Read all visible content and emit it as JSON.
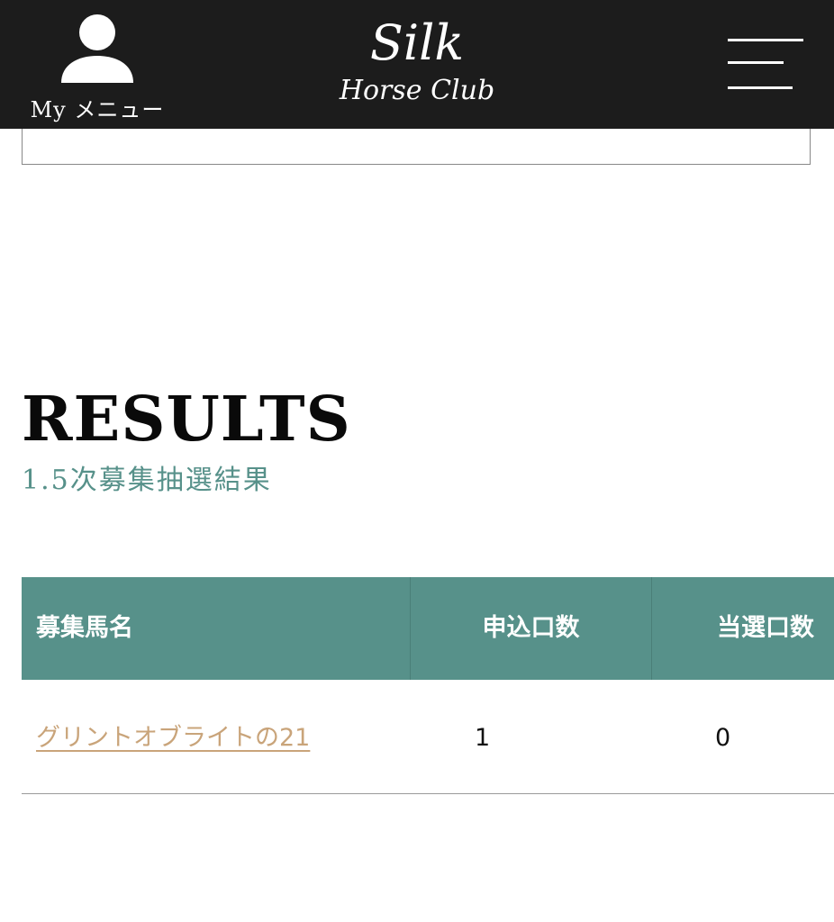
{
  "header": {
    "my_menu_label": "My メニュー",
    "logo_top": "Silk",
    "logo_bottom": "Horse Club"
  },
  "section": {
    "heading": "RESULTS",
    "subheading": "1.5次募集抽選結果"
  },
  "table": {
    "columns": [
      "募集馬名",
      "申込口数",
      "当選口数"
    ],
    "rows": [
      {
        "name": "グリントオブライトの21",
        "applied": "1",
        "won": "0"
      }
    ]
  },
  "colors": {
    "header_bg": "#1c1c1c",
    "accent": "#57918a",
    "link": "#c9a47a"
  },
  "icons": [
    "user-icon",
    "hamburger-menu-icon"
  ]
}
